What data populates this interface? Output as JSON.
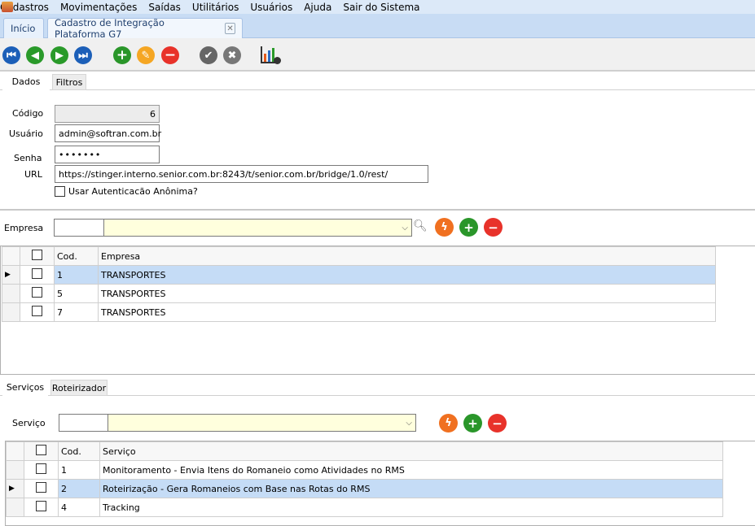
{
  "menu": [
    "Cadastros",
    "Movimentações",
    "Saídas",
    "Utilitários",
    "Usuários",
    "Ajuda",
    "Sair do Sistema"
  ],
  "tabs": {
    "home": "Início",
    "active": "Cadastro de Integração Plataforma G7"
  },
  "subtabs": [
    "Dados",
    "Filtros"
  ],
  "form": {
    "codigo_label": "Código",
    "codigo": "6",
    "usuario_label": "Usuário",
    "usuario": "admin@softran.com.br",
    "senha_label": "Senha",
    "senha": "•••••••",
    "url_label": "URL",
    "url": "https://stinger.interno.senior.com.br:8243/t/senior.com.br/bridge/1.0/rest/",
    "anon_label": "Usar Autenticacão Anônima?"
  },
  "empresa": {
    "label": "Empresa",
    "code": "",
    "value": "",
    "columns": [
      "Cod.",
      "Empresa"
    ],
    "rows": [
      {
        "cod": "1",
        "nome": "TRANSPORTES",
        "selected": true
      },
      {
        "cod": "5",
        "nome": "TRANSPORTES",
        "selected": false
      },
      {
        "cod": "7",
        "nome": "TRANSPORTES",
        "selected": false
      }
    ]
  },
  "bottom_tabs": [
    "Serviços",
    "Roteirizador"
  ],
  "servico": {
    "label": "Serviço",
    "code": "",
    "value": "",
    "columns": [
      "Cod.",
      "Serviço"
    ],
    "rows": [
      {
        "cod": "1",
        "nome": "Monitoramento - Envia Itens do Romaneio como Atividades no RMS",
        "selected": false
      },
      {
        "cod": "2",
        "nome": "Roteirização - Gera Romaneios com Base nas Rotas do RMS",
        "selected": true
      },
      {
        "cod": "4",
        "nome": "Tracking",
        "selected": false
      }
    ]
  }
}
